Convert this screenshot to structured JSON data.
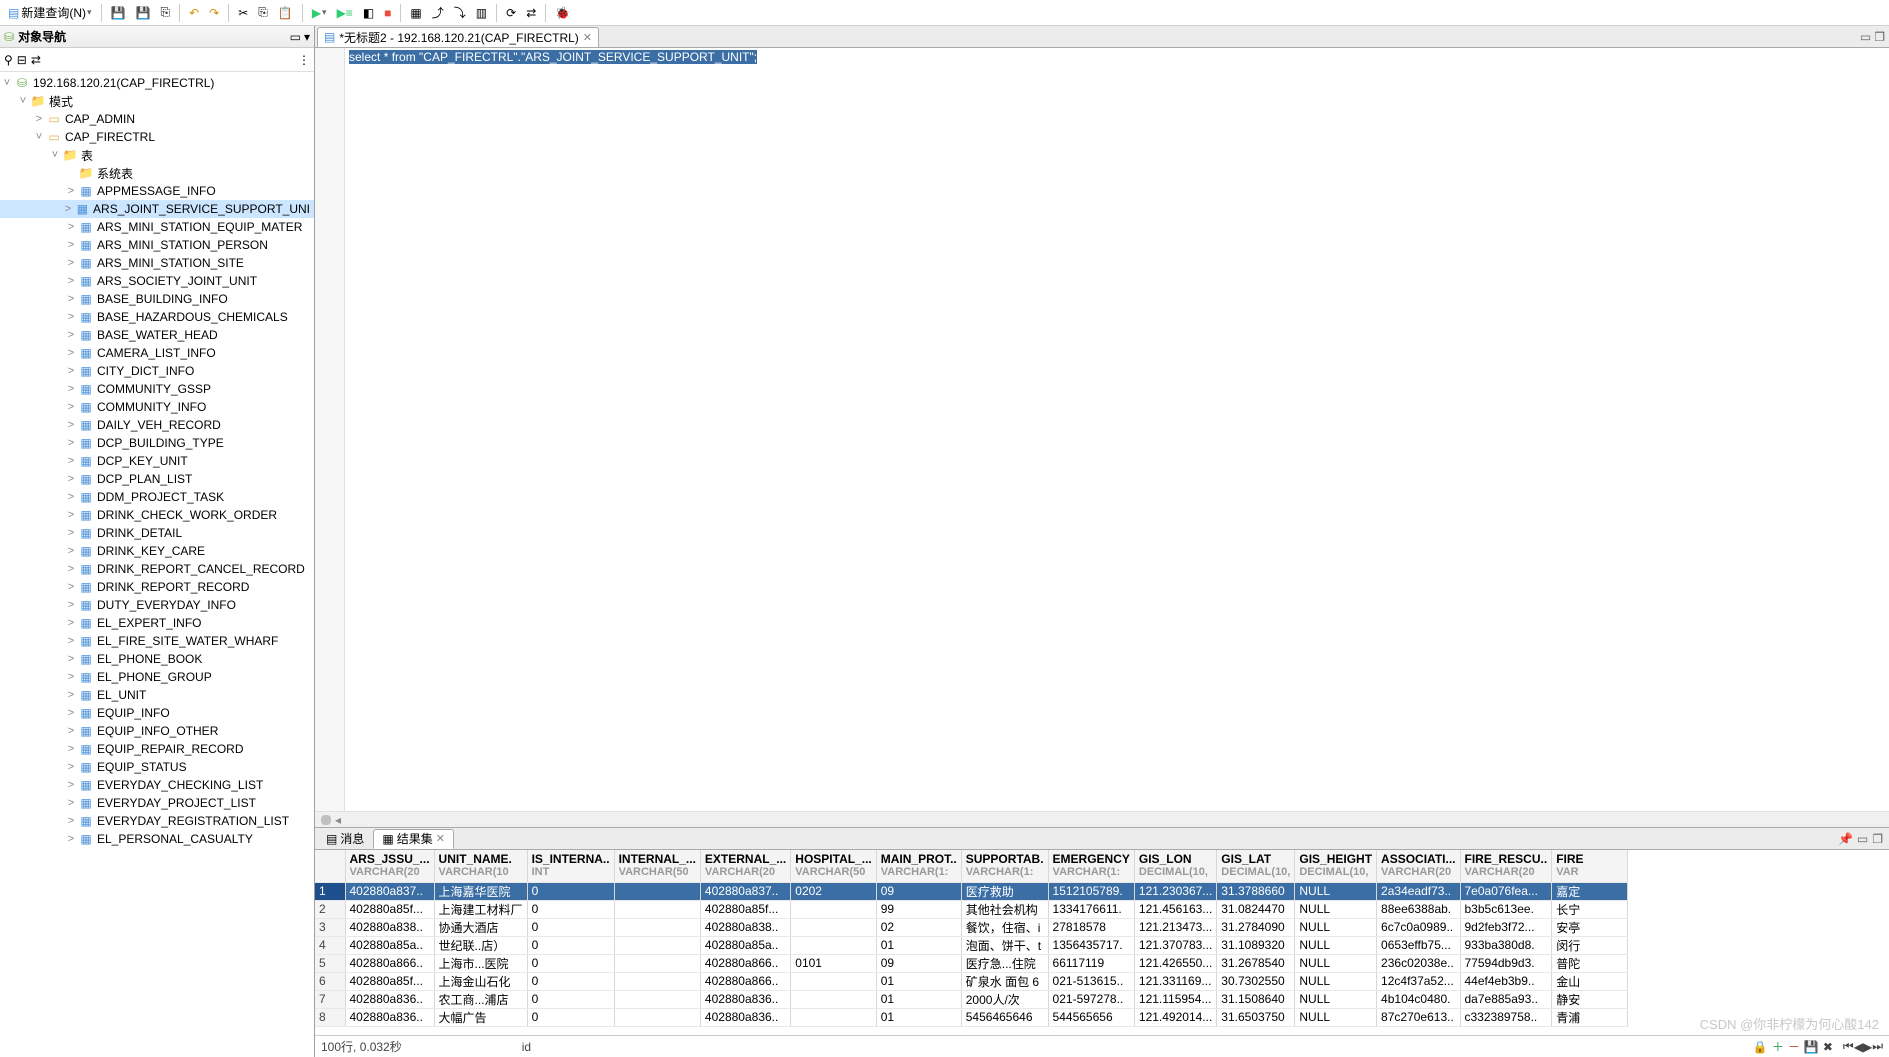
{
  "toolbar": {
    "new_query": "新建查询(N)"
  },
  "sidebar": {
    "title": "对象导航",
    "root": "192.168.120.21(CAP_FIRECTRL)",
    "schemas_label": "模式",
    "schema1": "CAP_ADMIN",
    "schema2": "CAP_FIRECTRL",
    "tables_label": "表",
    "systables_label": "系统表",
    "tables": [
      "APPMESSAGE_INFO",
      "ARS_JOINT_SERVICE_SUPPORT_UNI",
      "ARS_MINI_STATION_EQUIP_MATER",
      "ARS_MINI_STATION_PERSON",
      "ARS_MINI_STATION_SITE",
      "ARS_SOCIETY_JOINT_UNIT",
      "BASE_BUILDING_INFO",
      "BASE_HAZARDOUS_CHEMICALS",
      "BASE_WATER_HEAD",
      "CAMERA_LIST_INFO",
      "CITY_DICT_INFO",
      "COMMUNITY_GSSP",
      "COMMUNITY_INFO",
      "DAILY_VEH_RECORD",
      "DCP_BUILDING_TYPE",
      "DCP_KEY_UNIT",
      "DCP_PLAN_LIST",
      "DDM_PROJECT_TASK",
      "DRINK_CHECK_WORK_ORDER",
      "DRINK_DETAIL",
      "DRINK_KEY_CARE",
      "DRINK_REPORT_CANCEL_RECORD",
      "DRINK_REPORT_RECORD",
      "DUTY_EVERYDAY_INFO",
      "EL_EXPERT_INFO",
      "EL_FIRE_SITE_WATER_WHARF",
      "EL_PHONE_BOOK",
      "EL_PHONE_GROUP",
      "EL_UNIT",
      "EQUIP_INFO",
      "EQUIP_INFO_OTHER",
      "EQUIP_REPAIR_RECORD",
      "EQUIP_STATUS",
      "EVERYDAY_CHECKING_LIST",
      "EVERYDAY_PROJECT_LIST",
      "EVERYDAY_REGISTRATION_LIST",
      "EL_PERSONAL_CASUALTY"
    ]
  },
  "editor": {
    "tab_label": "*无标题2 - 192.168.120.21(CAP_FIRECTRL)",
    "sql": "select * from \"CAP_FIRECTRL\".\"ARS_JOINT_SERVICE_SUPPORT_UNIT\";"
  },
  "results": {
    "tab_messages": "消息",
    "tab_resultset": "结果集",
    "columns": [
      {
        "name": "ARS_JSSU_...",
        "type": "VARCHAR(20"
      },
      {
        "name": "UNIT_NAME.",
        "type": "VARCHAR(10"
      },
      {
        "name": "IS_INTERNA..",
        "type": "INT"
      },
      {
        "name": "INTERNAL_...",
        "type": "VARCHAR(50"
      },
      {
        "name": "EXTERNAL_...",
        "type": "VARCHAR(20"
      },
      {
        "name": "HOSPITAL_...",
        "type": "VARCHAR(50"
      },
      {
        "name": "MAIN_PROT..",
        "type": "VARCHAR(1:"
      },
      {
        "name": "SUPPORTAB.",
        "type": "VARCHAR(1:"
      },
      {
        "name": "EMERGENCY",
        "type": "VARCHAR(1:"
      },
      {
        "name": "GIS_LON",
        "type": "DECIMAL(10,"
      },
      {
        "name": "GIS_LAT",
        "type": "DECIMAL(10,"
      },
      {
        "name": "GIS_HEIGHT",
        "type": "DECIMAL(10,"
      },
      {
        "name": "ASSOCIATI...",
        "type": "VARCHAR(20"
      },
      {
        "name": "FIRE_RESCU..",
        "type": "VARCHAR(20"
      },
      {
        "name": "FIRE",
        "type": "VAR"
      }
    ],
    "rows": [
      [
        "402880a837..",
        "上海嘉华医院",
        "0",
        "",
        "402880a837..",
        "0202",
        "09",
        "医疗救助",
        "1512105789.",
        "121.230367...",
        "31.3788660",
        "NULL",
        "2a34eadf73..",
        "7e0a076fea...",
        "嘉定"
      ],
      [
        "402880a85f...",
        "上海建工材料厂",
        "0",
        "",
        "402880a85f...",
        "",
        "99",
        "其他社会机构",
        "1334176611.",
        "121.456163...",
        "31.0824470",
        "NULL",
        "88ee6388ab.",
        "b3b5c613ee.",
        "长宁"
      ],
      [
        "402880a838..",
        "协通大酒店",
        "0",
        "",
        "402880a838..",
        "",
        "02",
        "餐饮，住宿、i",
        "27818578",
        "121.213473...",
        "31.2784090",
        "NULL",
        "6c7c0a0989..",
        "9d2feb3f72...",
        "安亭"
      ],
      [
        "402880a85a..",
        "世纪联..店）",
        "0",
        "",
        "402880a85a..",
        "",
        "01",
        "泡面、饼干、t",
        "1356435717.",
        "121.370783...",
        "31.1089320",
        "NULL",
        "0653effb75...",
        "933ba380d8.",
        "闵行"
      ],
      [
        "402880a866..",
        "上海市...医院",
        "0",
        "",
        "402880a866..",
        "0101",
        "09",
        "医疗急...住院",
        "66117119",
        "121.426550...",
        "31.2678540",
        "NULL",
        "236c02038e..",
        "77594db9d3.",
        "普陀"
      ],
      [
        "402880a85f...",
        "上海金山石化",
        "0",
        "",
        "402880a866..",
        "",
        "01",
        "矿泉水 面包 6",
        "021-513615..",
        "121.331169...",
        "30.7302550",
        "NULL",
        "12c4f37a52...",
        "44ef4eb3b9..",
        "金山"
      ],
      [
        "402880a836..",
        "农工商...浦店",
        "0",
        "",
        "402880a836..",
        "",
        "01",
        "2000人/次",
        "021-597278..",
        "121.115954...",
        "31.1508640",
        "NULL",
        "4b104c0480.",
        "da7e885a93..",
        "静安"
      ],
      [
        "402880a836..",
        "大幅广告",
        "0",
        "",
        "402880a836..",
        "",
        "01",
        "5456465646",
        "544565656",
        "121.492014...",
        "31.6503750",
        "NULL",
        "87c270e613..",
        "c332389758..",
        "青浦"
      ]
    ],
    "status_left": "100行, 0.032秒",
    "status_col": "id"
  },
  "watermark": "CSDN @你非柠檬为何心酸142"
}
